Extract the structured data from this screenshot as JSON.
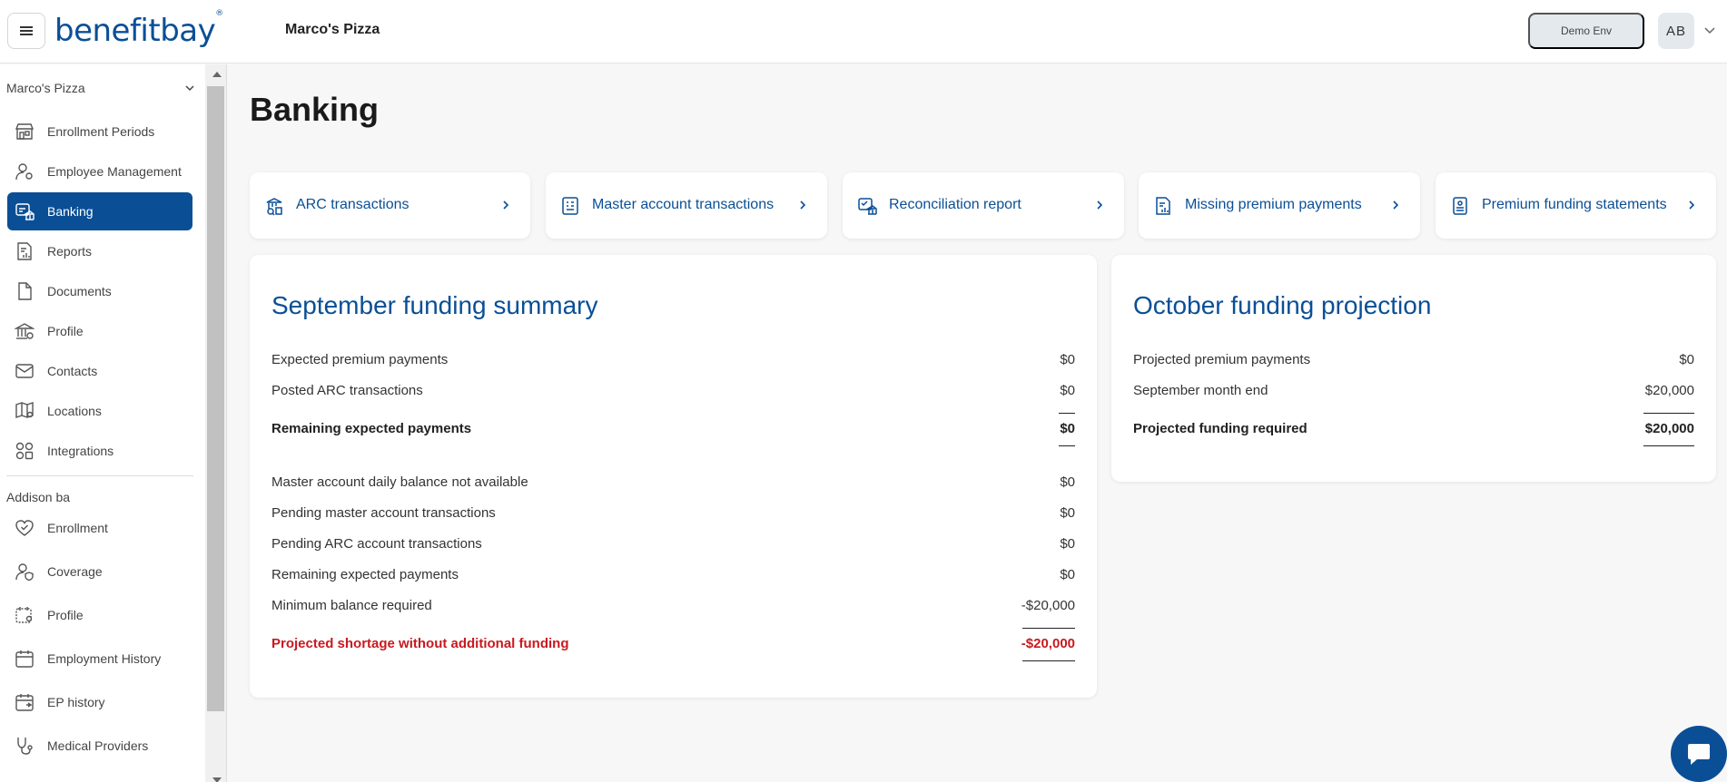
{
  "header": {
    "logo_text": "benefitbay",
    "logo_mark": "®",
    "company_name": "Marco's Pizza",
    "env_label": "Demo Env",
    "avatar_initials": "AB"
  },
  "sidebar": {
    "org_name": "Marco's Pizza",
    "items": [
      {
        "label": "Enrollment Periods",
        "icon": "store-icon"
      },
      {
        "label": "Employee Management",
        "icon": "user-gear-icon"
      },
      {
        "label": "Banking",
        "icon": "banking-icon",
        "active": true
      },
      {
        "label": "Reports",
        "icon": "report-icon"
      },
      {
        "label": "Documents",
        "icon": "document-icon"
      },
      {
        "label": "Profile",
        "icon": "bank-building-icon"
      },
      {
        "label": "Contacts",
        "icon": "mail-icon"
      },
      {
        "label": "Locations",
        "icon": "map-icon"
      },
      {
        "label": "Integrations",
        "icon": "integrations-icon"
      }
    ],
    "section_label": "Addison ba",
    "member_items": [
      {
        "label": "Enrollment",
        "icon": "heart-check-icon"
      },
      {
        "label": "Coverage",
        "icon": "user-shield-icon"
      },
      {
        "label": "Profile",
        "icon": "calendar-user-icon"
      },
      {
        "label": "Employment History",
        "icon": "calendar-icon"
      },
      {
        "label": "EP history",
        "icon": "calendar-history-icon"
      },
      {
        "label": "Medical Providers",
        "icon": "stethoscope-icon"
      }
    ]
  },
  "main": {
    "title": "Banking",
    "links": [
      {
        "label": "ARC transactions",
        "icon": "bank-search-icon"
      },
      {
        "label": "Master account transactions",
        "icon": "ledger-icon"
      },
      {
        "label": "Reconciliation report",
        "icon": "reconcile-icon"
      },
      {
        "label": "Missing premium payments",
        "icon": "missing-report-icon"
      },
      {
        "label": "Premium funding statements",
        "icon": "statement-icon"
      }
    ],
    "september": {
      "title": "September funding summary",
      "expected_label": "Expected premium payments",
      "expected_value": "$0",
      "posted_label": "Posted ARC transactions",
      "posted_value": "$0",
      "remaining_label": "Remaining expected payments",
      "remaining_value": "$0",
      "master_label": "Master account daily balance not available",
      "master_value": "$0",
      "pending_master_label": "Pending master account transactions",
      "pending_master_value": "$0",
      "pending_arc_label": "Pending ARC account transactions",
      "pending_arc_value": "$0",
      "remaining2_label": "Remaining expected payments",
      "remaining2_value": "$0",
      "minimum_label": "Minimum balance required",
      "minimum_value": "-$20,000",
      "shortage_label": "Projected shortage without additional funding",
      "shortage_value": "-$20,000"
    },
    "october": {
      "title": "October funding projection",
      "projected_label": "Projected premium payments",
      "projected_value": "$0",
      "month_end_label": "September month end",
      "month_end_value": "$20,000",
      "required_label": "Projected funding required",
      "required_value": "$20,000"
    }
  },
  "colors": {
    "brand": "#0a4f96",
    "negative": "#c9191e",
    "background": "#f7f7f7"
  }
}
